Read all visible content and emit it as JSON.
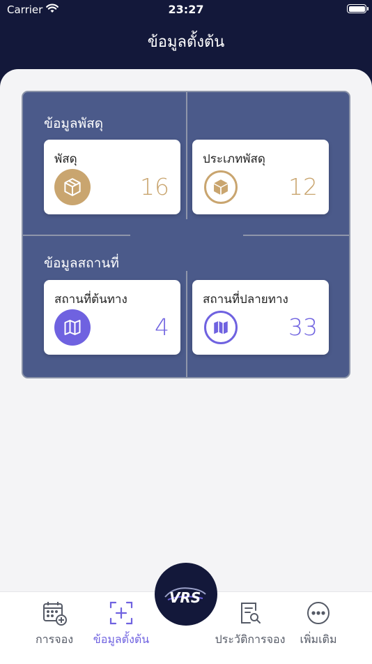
{
  "status": {
    "carrier": "Carrier",
    "time": "23:27"
  },
  "header": {
    "title": "ข้อมูลตั้งต้น"
  },
  "sections": {
    "parcel": {
      "title": "ข้อมูลพัสดุ",
      "cards": [
        {
          "label": "พัสดุ",
          "count": "16",
          "icon": "box-icon"
        },
        {
          "label": "ประเภทพัสดุ",
          "count": "12",
          "icon": "box-category-icon"
        }
      ]
    },
    "location": {
      "title": "ข้อมูลสถานที่",
      "cards": [
        {
          "label": "สถานที่ต้นทาง",
          "count": "4",
          "icon": "map-icon"
        },
        {
          "label": "สถานที่ปลายทาง",
          "count": "33",
          "icon": "map-outline-icon"
        }
      ]
    }
  },
  "tabbar": {
    "items": [
      {
        "label": "การจอง",
        "icon": "calendar-add-icon"
      },
      {
        "label": "ข้อมูลตั้งต้น",
        "icon": "scan-add-icon",
        "active": true
      },
      {
        "label": "ประวัติการจอง",
        "icon": "document-search-icon"
      },
      {
        "label": "เพิ่มเติม",
        "icon": "more-icon"
      }
    ],
    "center_logo": "VRS"
  },
  "colors": {
    "navy": "#13183a",
    "panel": "#4b5a8a",
    "gold": "#c9a56f",
    "purple": "#6f62e0",
    "tab_gray": "#555a66"
  }
}
